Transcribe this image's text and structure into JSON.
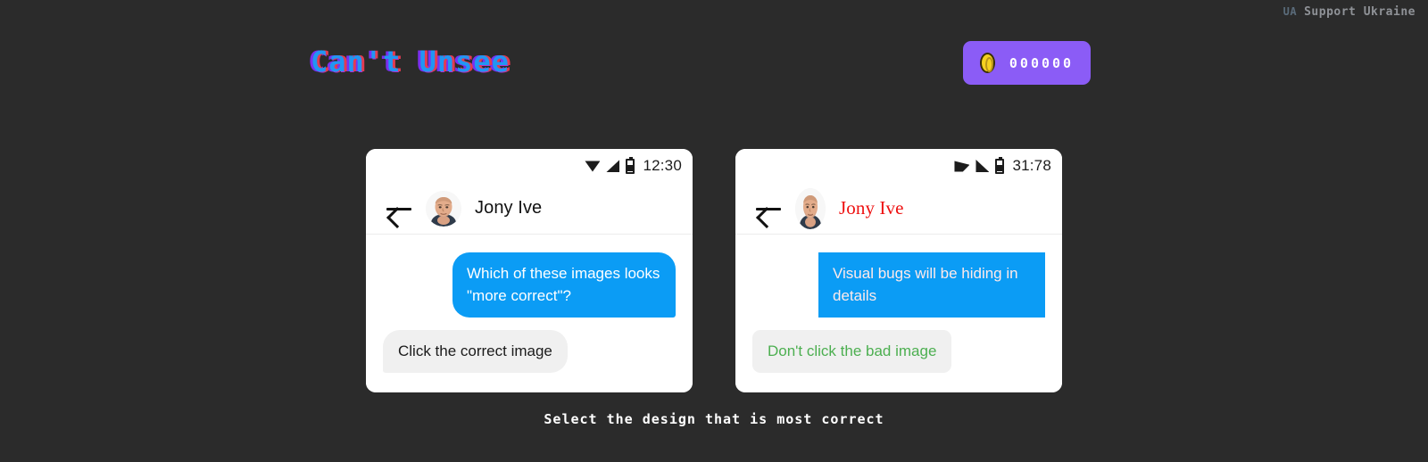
{
  "banner": {
    "tag": "UA",
    "text": "Support Ukraine"
  },
  "header": {
    "logo": "Can't Unsee",
    "coin_icon": "coin-icon",
    "coin_count": "000000",
    "coin_bg": "#8b5cf6"
  },
  "cards": [
    {
      "id": "left",
      "statusbar": {
        "wifi_icon": "wifi-icon",
        "signal_icon": "signal-icon",
        "battery_icon": "battery-icon",
        "time": "12:30"
      },
      "chat_header": {
        "back_icon": "back-arrow-icon",
        "avatar": "contact-avatar",
        "name": "Jony Ive"
      },
      "messages": [
        {
          "side": "out",
          "text": "Which of these images looks \"more correct\"?"
        },
        {
          "side": "in",
          "text": "Click the correct image"
        }
      ]
    },
    {
      "id": "right",
      "statusbar": {
        "wifi_icon": "wifi-icon",
        "signal_icon": "signal-icon",
        "battery_icon": "battery-icon",
        "time": "31:78"
      },
      "chat_header": {
        "back_icon": "back-arrow-icon",
        "avatar": "contact-avatar",
        "name": "Jony Ive"
      },
      "messages": [
        {
          "side": "out",
          "text": "Visual bugs will be hiding in details"
        },
        {
          "side": "in",
          "text": "Don't click the bad image"
        }
      ]
    }
  ],
  "caption": "Select the design that is most correct",
  "colors": {
    "page_bg": "#2b2b2b",
    "bubble_out": "#0b9cf5",
    "bubble_in": "#f0f0f0",
    "accent_purple": "#8b5cf6",
    "bug_red": "#ee1111",
    "bug_green": "#4caf50"
  }
}
